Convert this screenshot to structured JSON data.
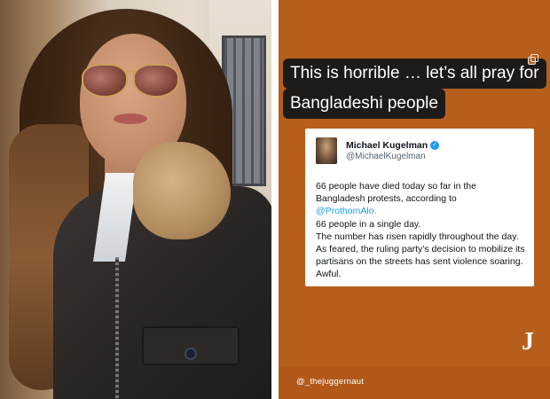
{
  "left_photo": {
    "icon": "portrait-photo"
  },
  "story": {
    "caption_lines": [
      "This is horrible … let’s all pray for",
      "Bangladeshi people"
    ],
    "copy_icon": "copy-icon",
    "background_color": "#b65f1c",
    "tweet": {
      "name": "Michael Kugelman",
      "handle": "@MichaelKugelman",
      "verified_icon": "verified-badge-icon",
      "body_line1": "66 people have died today so far in the Bangladesh protests, according to",
      "body_link": "@ProthomAlo.",
      "body_line2": "66 people in a single day.",
      "body_line3": "The number has risen rapidly throughout the day. As feared, the ruling party’s decision to mobilize its partisans on the streets has sent violence soaring. Awful."
    },
    "logo": "J",
    "watermark": "@_thejuggernaut"
  }
}
